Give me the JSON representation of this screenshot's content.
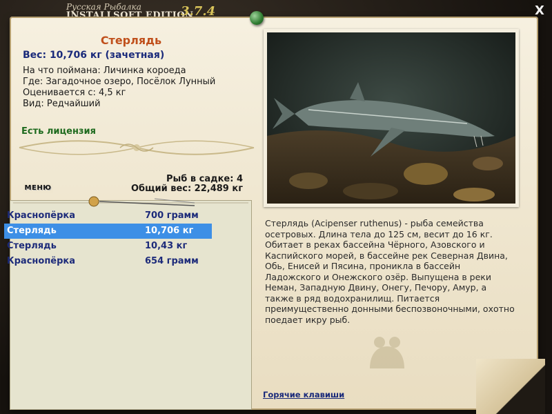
{
  "window": {
    "logo_line1": "Русская Рыбалка",
    "logo_line2": "INSTALLSOFT EDITION",
    "version": "3.7.4",
    "close_label": "X"
  },
  "fish": {
    "name": "Стерлядь",
    "weight_line": "Вес: 10,706 кг (зачетная)",
    "info": [
      "На что поймана: Личинка короеда",
      "Где: Загадочное озеро, Посёлок Лунный",
      "Оценивается с: 4,5 кг",
      "Вид: Редчайший"
    ],
    "license": "Есть лицензия"
  },
  "stats": {
    "count": "Рыб в садке: 4",
    "total_weight": "Общий вес: 22,489 кг"
  },
  "menu_label": "МЕНЮ",
  "catch_list": [
    {
      "name": "Краснопёрка",
      "weight": "700 грамм",
      "selected": false
    },
    {
      "name": "Стерлядь",
      "weight": "10,706 кг",
      "selected": true
    },
    {
      "name": "Стерлядь",
      "weight": "10,43 кг",
      "selected": false
    },
    {
      "name": "Краснопёрка",
      "weight": "654 грамм",
      "selected": false
    }
  ],
  "description": "Стерлядь (Acipenser ruthenus) - рыба семейства осетровых. Длина тела до 125 см, весит до 16 кг. Обитает в реках бассейна Чёрного, Азовского и Каспийского морей, в бассейне рек Северная Двина, Обь, Енисей и Пясина, проникла в бассейн Ладожского и Онежского озёр. Выпущена в реки Неман, Западную Двину, Онегу, Печору, Амур, а также в ряд водохранилищ. Питается преимущественно донными беспозвоночными, охотно поедает икру рыб.",
  "hotkeys_label": "Горячие клавиши",
  "colors": {
    "fish_name": "#c0501c",
    "weight": "#1a2a7a",
    "license": "#1e6a1e",
    "list_text": "#1d2b7a",
    "selected_row": "#3d8fe6",
    "version": "#d9c45a"
  }
}
